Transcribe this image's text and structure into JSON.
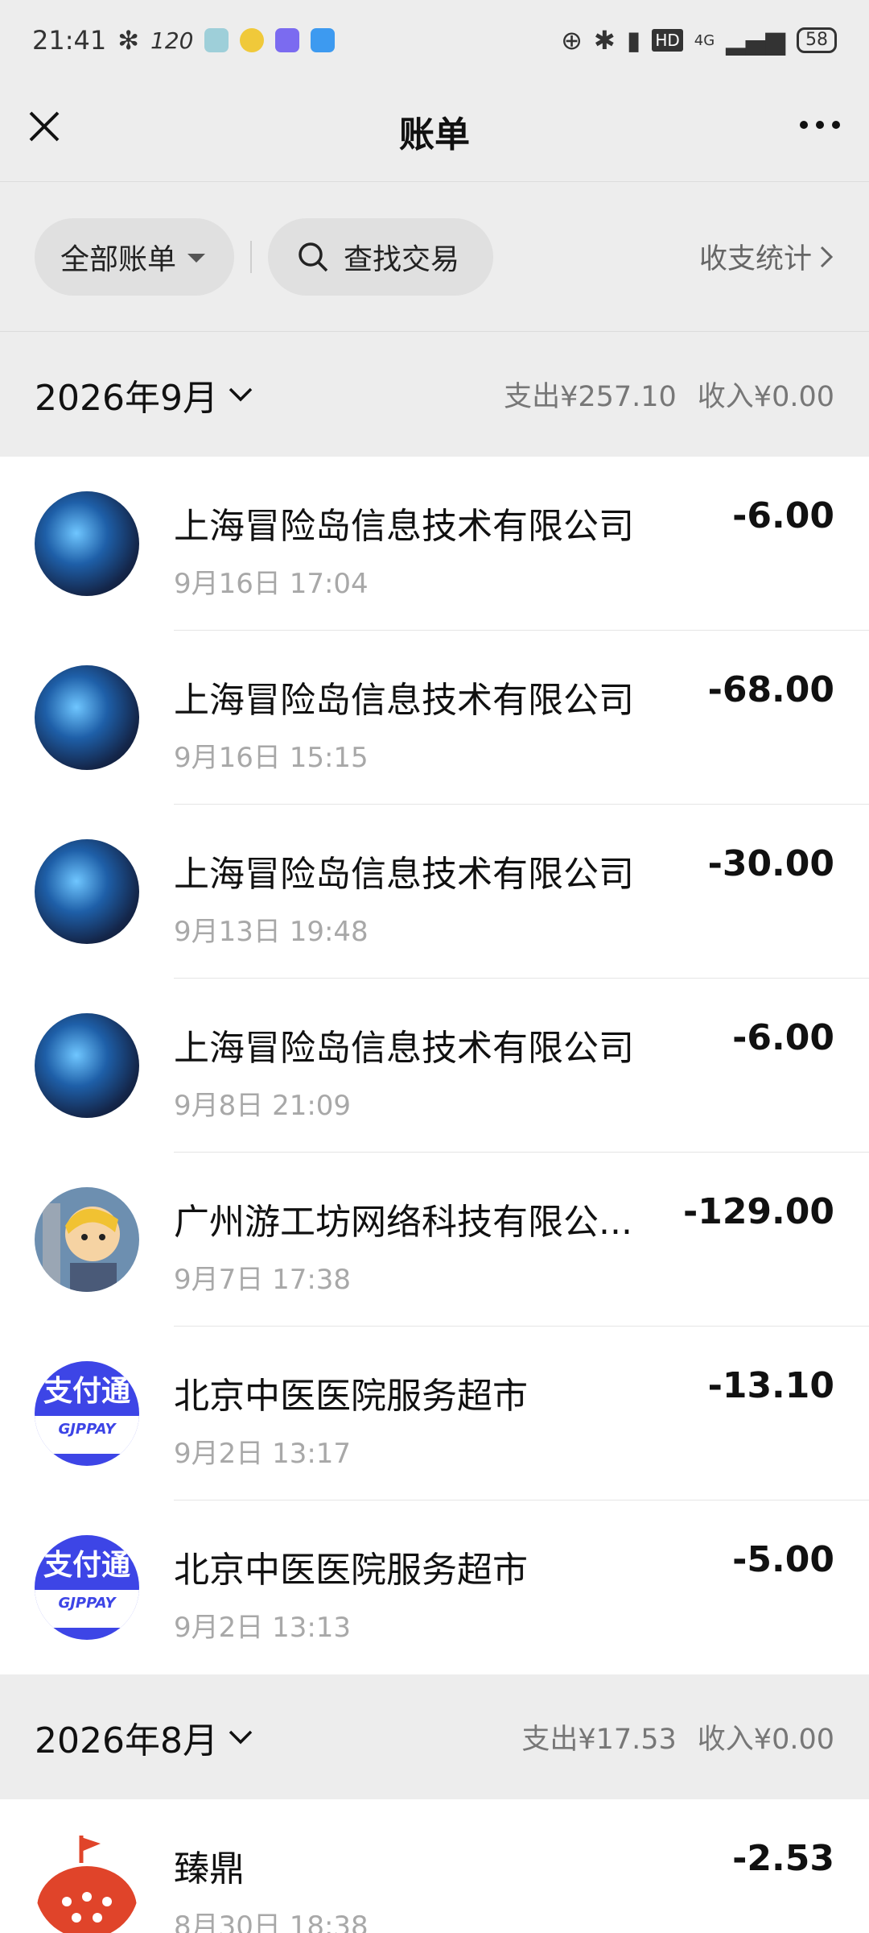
{
  "status_bar": {
    "time": "21:41",
    "refresh_rate": "120",
    "battery": "58",
    "network": "4G"
  },
  "header": {
    "title": "账单"
  },
  "filters": {
    "all_label": "全部账单",
    "search_label": "查找交易",
    "stats_label": "收支统计"
  },
  "months": [
    {
      "title": "2026年9月",
      "expense": "支出¥257.10",
      "income": "收入¥0.00",
      "transactions": [
        {
          "name": "上海冒险岛信息技术有限公司",
          "time": "9月16日 17:04",
          "amount": "-6.00",
          "avatar": "game-avatar"
        },
        {
          "name": "上海冒险岛信息技术有限公司",
          "time": "9月16日 15:15",
          "amount": "-68.00",
          "avatar": "game-avatar"
        },
        {
          "name": "上海冒险岛信息技术有限公司",
          "time": "9月13日 19:48",
          "amount": "-30.00",
          "avatar": "game-avatar"
        },
        {
          "name": "上海冒险岛信息技术有限公司",
          "time": "9月8日 21:09",
          "amount": "-6.00",
          "avatar": "game-avatar"
        },
        {
          "name": "广州游工坊网络科技有限公...",
          "time": "9月7日 17:38",
          "amount": "-129.00",
          "avatar": "hero-avatar"
        },
        {
          "name": "北京中医医院服务超市",
          "time": "9月2日 13:17",
          "amount": "-13.10",
          "avatar": "zhifutong-logo"
        },
        {
          "name": "北京中医医院服务超市",
          "time": "9月2日 13:13",
          "amount": "-5.00",
          "avatar": "zhifutong-logo"
        }
      ]
    },
    {
      "title": "2026年8月",
      "expense": "支出¥17.53",
      "income": "收入¥0.00",
      "transactions": [
        {
          "name": "臻鼎",
          "time": "8月30日 18:38",
          "amount": "-2.53",
          "avatar": "tomato-logo"
        }
      ]
    }
  ],
  "logos": {
    "zhifutong_text": "支付通",
    "zhifutong_sub": "GJPPAY"
  }
}
